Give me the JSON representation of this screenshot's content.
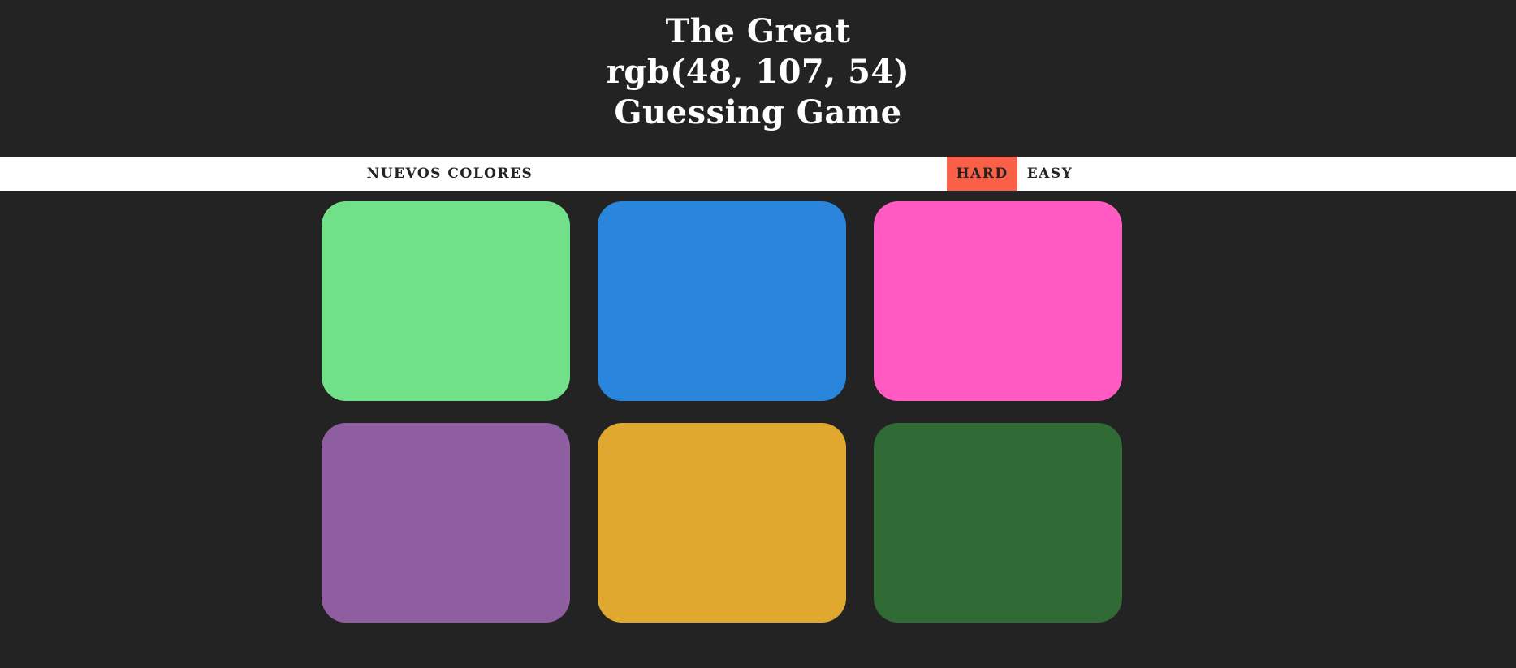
{
  "header": {
    "title_line1": "The Great",
    "title_line2": "rgb(48, 107, 54)",
    "title_line3": "Guessing Game"
  },
  "stripe": {
    "reset_label": "NUEVOS COLORES",
    "hard_label": "HARD",
    "easy_label": "EASY",
    "selected_mode": "hard",
    "selected_color": "#fa5f47"
  },
  "squares": [
    {
      "color": "#71e189"
    },
    {
      "color": "#2a86dc"
    },
    {
      "color": "#ff5bc3"
    },
    {
      "color": "#8e5ea1"
    },
    {
      "color": "#e0a82e"
    },
    {
      "color": "#306b36"
    }
  ],
  "colors": {
    "background": "#232323",
    "stripe": "#ffffff",
    "text_light": "#ffffff",
    "text_dark": "#232323"
  }
}
